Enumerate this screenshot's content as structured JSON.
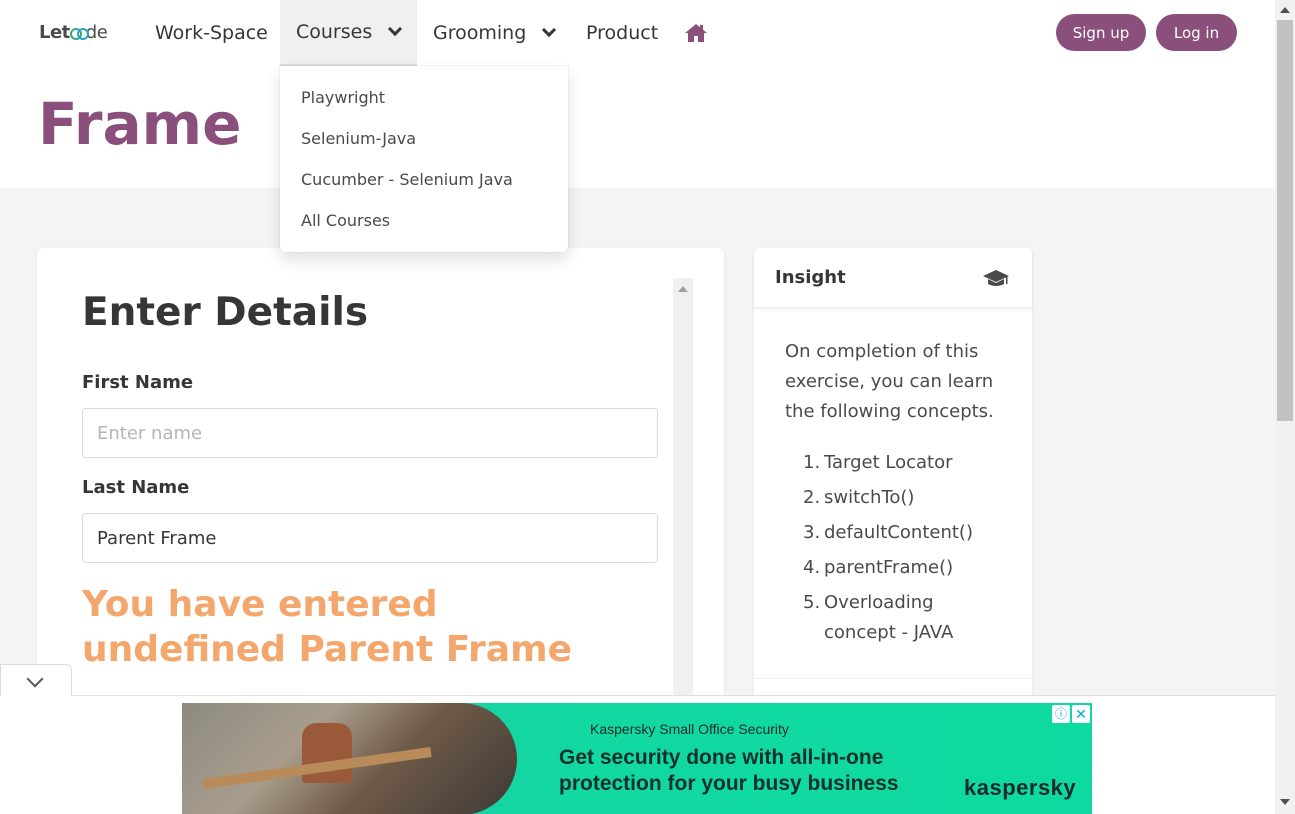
{
  "navbar": {
    "logo_left": "Let",
    "logo_right": "de",
    "items": [
      {
        "label": "Work-Space"
      },
      {
        "label": "Courses"
      },
      {
        "label": "Grooming"
      },
      {
        "label": "Product"
      }
    ],
    "home_icon": "home-icon",
    "signup_label": "Sign up",
    "login_label": "Log in",
    "accent_color": "#8b4f7b"
  },
  "courses_menu": {
    "items": [
      "Playwright",
      "Selenium-Java",
      "Cucumber - Selenium Java",
      "All Courses"
    ]
  },
  "hero": {
    "title": "Frame"
  },
  "form": {
    "title": "Enter Details",
    "first_name_label": "First Name",
    "first_name_placeholder": "Enter name",
    "first_name_value": "",
    "last_name_label": "Last Name",
    "last_name_value": "Parent Frame",
    "result_text": "You have entered undefined Parent Frame",
    "result_color": "#f4a76c"
  },
  "insight": {
    "title": "Insight",
    "icon": "graduation-cap-icon",
    "description": "On completion of this exercise, you can learn the following concepts.",
    "concepts": [
      {
        "num": "1.",
        "text": "Target Locator"
      },
      {
        "num": "2.",
        "text": "switchTo()"
      },
      {
        "num": "3.",
        "text": "defaultContent()"
      },
      {
        "num": "4.",
        "text": "parentFrame()"
      },
      {
        "num": "5.",
        "text": "Overloading concept - JAVA"
      }
    ]
  },
  "ad": {
    "brand_line": "Kaspersky Small Office Security",
    "headline": "Get security done with all-in-one protection for your busy business",
    "logo": "kaspersky",
    "info_symbol": "ⓘ",
    "close_symbol": "✕"
  }
}
